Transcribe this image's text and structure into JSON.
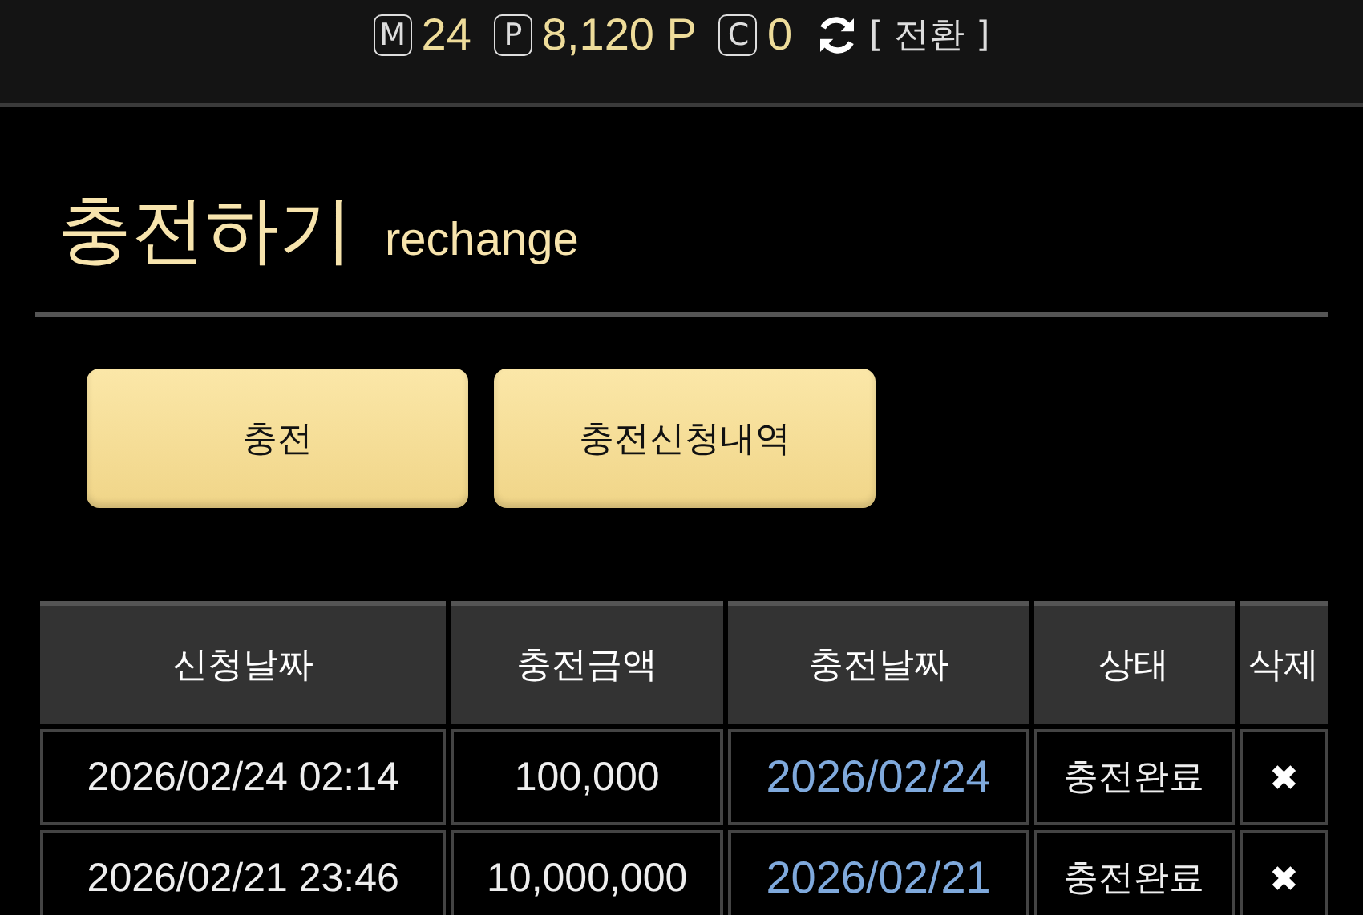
{
  "balance": [
    {
      "badge": "M",
      "value": "24"
    },
    {
      "badge": "P",
      "value": "8,120 P"
    },
    {
      "badge": "C",
      "value": "0"
    }
  ],
  "switch_label": "[ 전환 ]",
  "title": "충전하기",
  "subtitle": "rechange",
  "buttons": [
    "충전",
    "충전신청내역"
  ],
  "table": {
    "columns": [
      "신청날짜",
      "충전금액",
      "충전날짜",
      "상태",
      "삭제"
    ],
    "rows": [
      {
        "requested": "2026/02/24 02:14",
        "amount": "100,000",
        "charged": "2026/02/24",
        "status": "충전완료",
        "delete": "✖"
      },
      {
        "requested": "2026/02/21 23:46",
        "amount": "10,000,000",
        "charged": "2026/02/21",
        "status": "충전완료",
        "delete": "✖"
      }
    ]
  }
}
